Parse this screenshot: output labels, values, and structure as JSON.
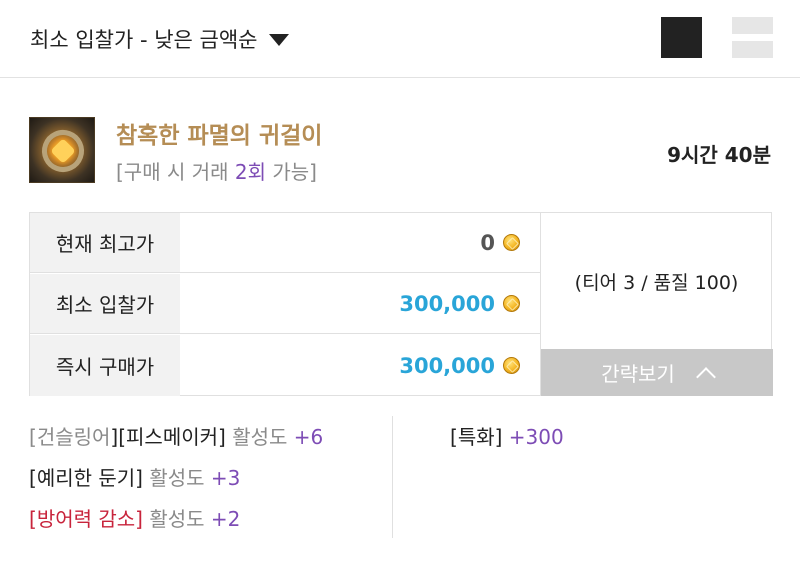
{
  "sort": {
    "label": "최소 입찰가 - 낮은 금액순"
  },
  "item": {
    "name": "참혹한 파멸의 귀걸이",
    "trade_prefix": "[구매 시 거래 ",
    "trade_count": "2회",
    "trade_suffix": " 가능]",
    "remaining_time": "9시간 40분"
  },
  "prices": [
    {
      "label": "현재 최고가",
      "value": "0",
      "highlight": false
    },
    {
      "label": "최소 입찰가",
      "value": "300,000",
      "highlight": true
    },
    {
      "label": "즉시 구매가",
      "value": "300,000",
      "highlight": true
    }
  ],
  "tier_quality": "(티어 3 / 품질 100)",
  "collapse_label": "간략보기",
  "effects_left": [
    {
      "open": "[",
      "name1": "건슬링어",
      "mid": "][",
      "name2": "피스메이커",
      "close": "]",
      "act": " 활성도 ",
      "plus": "+6"
    },
    {
      "open": "[",
      "name": "예리한 둔기",
      "close": "]",
      "act": " 활성도 ",
      "plus": "+3"
    },
    {
      "open": "[",
      "name": "방어력 감소",
      "close": "]",
      "act": " 활성도 ",
      "plus": "+2"
    }
  ],
  "effects_right": [
    {
      "open": "[",
      "name": "특화",
      "close": "]",
      "plus": " +300"
    }
  ],
  "colors": {
    "price_blue": "#29a5d8",
    "item_gold": "#b58d55",
    "purple": "#7d4cb5",
    "red": "#c8243c"
  },
  "icons": {
    "sort_caret": "caret-down-icon",
    "view_grid": "grid-view-icon",
    "view_list": "list-view-icon",
    "gold": "gold-coin-icon",
    "collapse": "chevron-up-icon",
    "item": "earring-item-icon"
  }
}
